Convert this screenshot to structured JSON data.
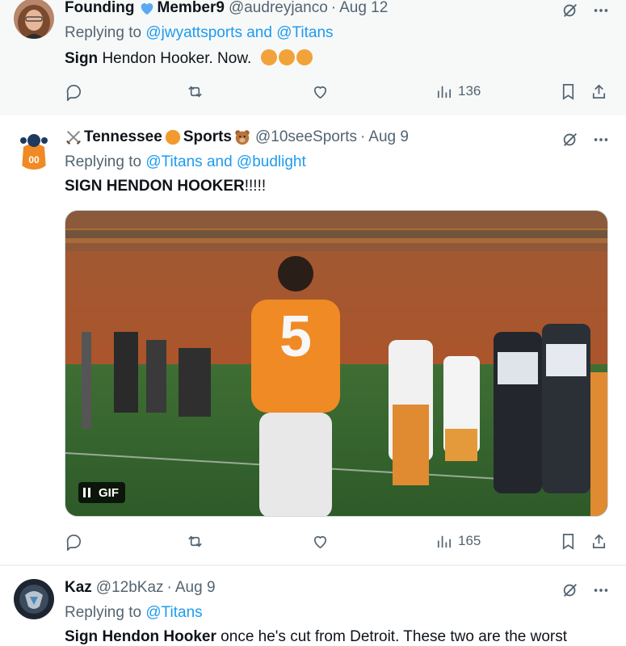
{
  "tweets": [
    {
      "display_name": "Founding",
      "display_name_suffix": "Member9",
      "handle": "@audreyjanco",
      "dot": "·",
      "date": "Aug 12",
      "replying_prefix": "Replying to",
      "replying_mentions": "@jwyattsports and @Titans",
      "text_bold": "Sign",
      "text_rest": " Hendon Hooker. Now.",
      "emojis": [
        "angry-face",
        "angry-face",
        "angry-face"
      ],
      "actions": {
        "reply_count": "",
        "retweet_count": "",
        "like_count": "",
        "views_count": "136"
      }
    },
    {
      "display_name_prefix_emoji": "crossed-swords",
      "display_name": "Tennessee",
      "display_name_mid_emoji": "orange-circle",
      "display_name_suffix": "Sports",
      "display_name_end_emoji": "bear-face",
      "handle": "@10seeSports",
      "dot": "·",
      "date": "Aug 9",
      "replying_prefix": "Replying to",
      "replying_mentions": "@Titans and @budlight",
      "text_bold": "SIGN HENDON HOOKER",
      "text_rest": "!!!!!",
      "media": {
        "type": "gif",
        "badge_label": "GIF",
        "jersey_number": "5"
      },
      "actions": {
        "reply_count": "",
        "retweet_count": "",
        "like_count": "",
        "views_count": "165"
      }
    },
    {
      "display_name": "Kaz",
      "handle": "@12bKaz",
      "dot": "·",
      "date": "Aug 9",
      "replying_prefix": "Replying to",
      "replying_mentions": "@Titans",
      "text_bold": "Sign Hendon Hooker",
      "text_rest": " once he's cut from Detroit. These two are the worst"
    }
  ],
  "colors": {
    "accent": "#1d9bf0",
    "text_primary": "#0f1419",
    "text_secondary": "#536471",
    "tennessee_orange": "#f08a24"
  }
}
